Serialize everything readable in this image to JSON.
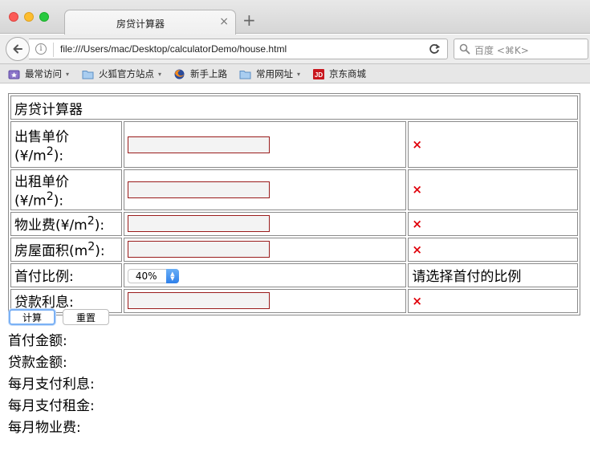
{
  "browser": {
    "tab_title": "房贷计算器",
    "tab_close": "×",
    "new_tab": "+",
    "url": "file:///Users/mac/Desktop/calculatorDemo/house.html",
    "search_placeholder": "百度 <⌘K>",
    "bookmarks": [
      {
        "label": "最常访问",
        "icon": "most-visited-icon",
        "has_menu": true
      },
      {
        "label": "火狐官方站点",
        "icon": "folder-icon",
        "has_menu": true
      },
      {
        "label": "新手上路",
        "icon": "firefox-icon",
        "has_menu": false
      },
      {
        "label": "常用网址",
        "icon": "folder-icon",
        "has_menu": true
      },
      {
        "label": "京东商城",
        "icon": "jd-icon",
        "has_menu": false
      }
    ],
    "bookmark_caret": "▾"
  },
  "calculator": {
    "title": "房贷计算器",
    "rows": {
      "sale_price": {
        "label_main": "出售单价",
        "label_unit_pre": "(¥/m",
        "label_unit_post": "):",
        "sup": "2",
        "value": "",
        "error": "×"
      },
      "rent_price": {
        "label_main": "出租单价",
        "label_unit_pre": "(¥/m",
        "label_unit_post": "):",
        "sup": "2",
        "value": "",
        "error": "×"
      },
      "property_fee": {
        "label_main": "物业费",
        "label_unit_pre": "(¥/m",
        "label_unit_post": "):",
        "sup": "2",
        "value": "",
        "error": "×"
      },
      "area": {
        "label_main": "房屋面积",
        "label_unit_pre": "(m",
        "label_unit_post": "):",
        "sup": "2",
        "value": "",
        "error": "×"
      },
      "down_payment_ratio": {
        "label": "首付比例:",
        "selected": "40%",
        "hint": "请选择首付的比例"
      },
      "interest": {
        "label": "贷款利息:",
        "value": "",
        "error": "×"
      }
    },
    "buttons": {
      "calculate": "计算",
      "reset": "重置"
    },
    "results": {
      "down_payment": "首付金额:",
      "loan_amount": "贷款金额:",
      "monthly_interest": "每月支付利息:",
      "monthly_rent": "每月支付租金:",
      "monthly_property_fee": "每月物业费:"
    }
  },
  "colors": {
    "error": "#e0000a",
    "input_border": "#9a1c1c",
    "focus": "#7bb1f5"
  }
}
